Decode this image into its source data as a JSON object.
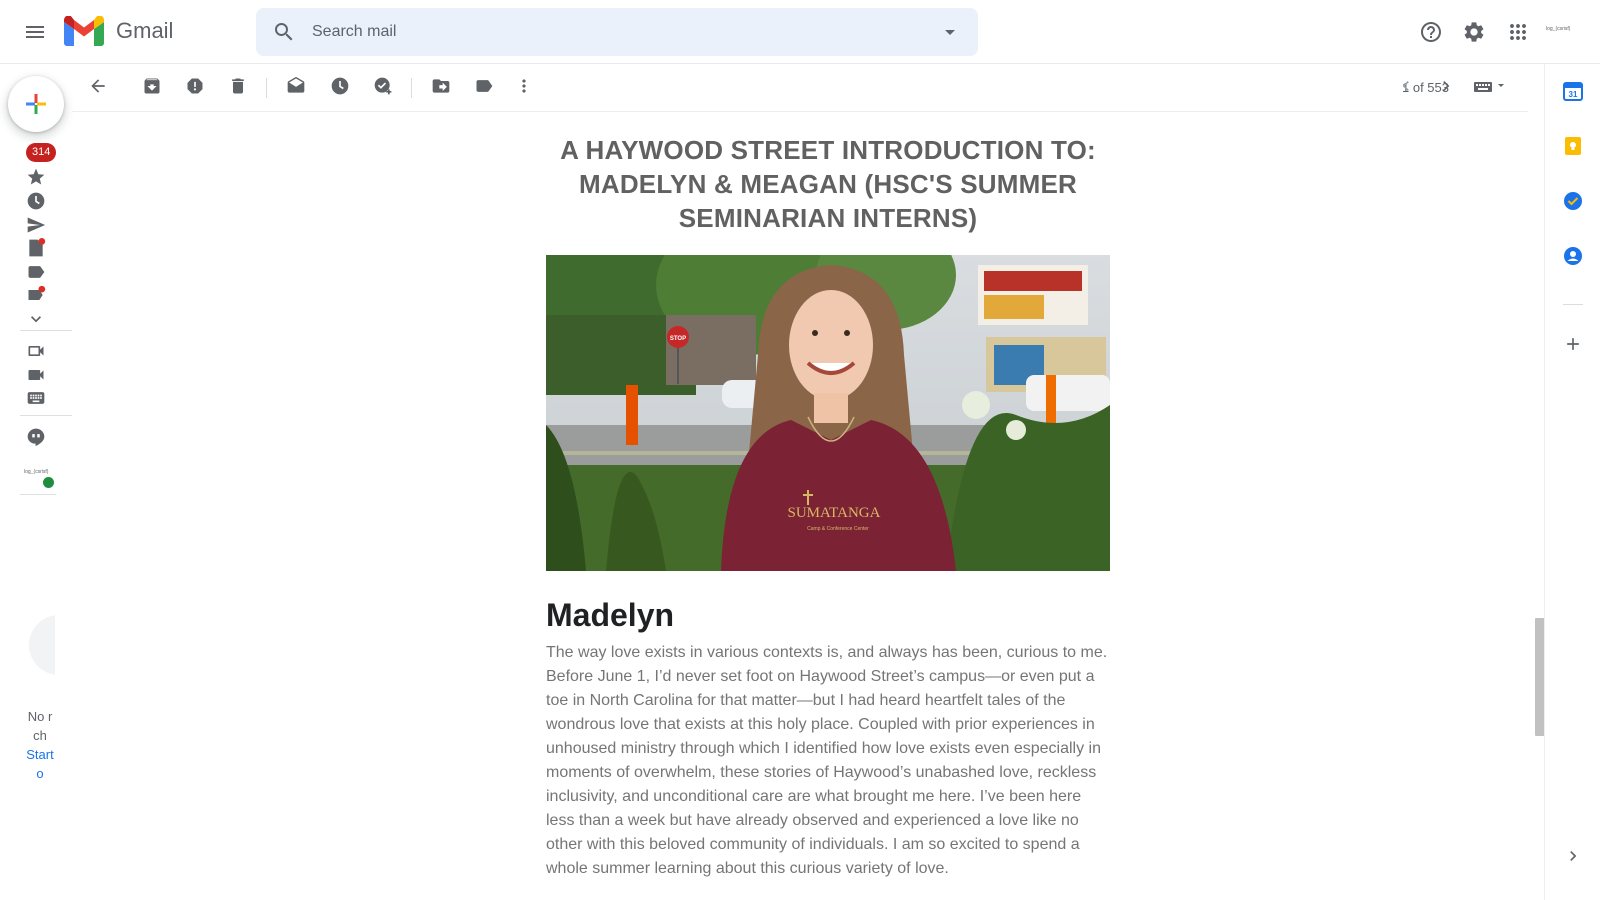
{
  "app": {
    "name": "Gmail"
  },
  "search": {
    "placeholder": "Search mail"
  },
  "account": {
    "tiny_label": "log_(csrisf)"
  },
  "leftrail": {
    "unread_count": "314",
    "tiny_label": "log_(csrisf)"
  },
  "chat": {
    "no_chats_line1": "No r",
    "no_chats_line2": "ch",
    "start_link": "Start",
    "start_link2": "o"
  },
  "toolbar": {
    "pager": "1 of 553"
  },
  "email": {
    "headline": "A HAYWOOD STREET INTRODUCTION TO: MADELYN & MEAGAN (HSC'S SUMMER SEMINARIAN INTERNS)",
    "photo_shirt_text": "SUMATANGA",
    "photo_shirt_subtext": "Camp & Conference Center",
    "photo_sign_text": "STOP",
    "section_title": "Madelyn",
    "paragraph": "The way love exists in various contexts is, and always has been, curious to me.  Before June 1, I’d never set foot on Haywood Street’s campus—or even put a toe in North Carolina for that matter—but I had heard heartfelt tales of the wondrous love that exists at this holy place.  Coupled with prior experiences in unhoused ministry through which I identified how love exists even especially in moments of overwhelm, these stories of Haywood’s unabashed love, reckless inclusivity, and unconditional care are what brought me here.  I’ve been here less than a week but have already observed and experienced a love like no other with this beloved community of individuals.  I am so excited to spend a whole summer learning about this curious variety of love."
  },
  "colors": {
    "badge": "#c5221f",
    "link": "#1a73e8",
    "search_bg": "#eaf1fb"
  }
}
